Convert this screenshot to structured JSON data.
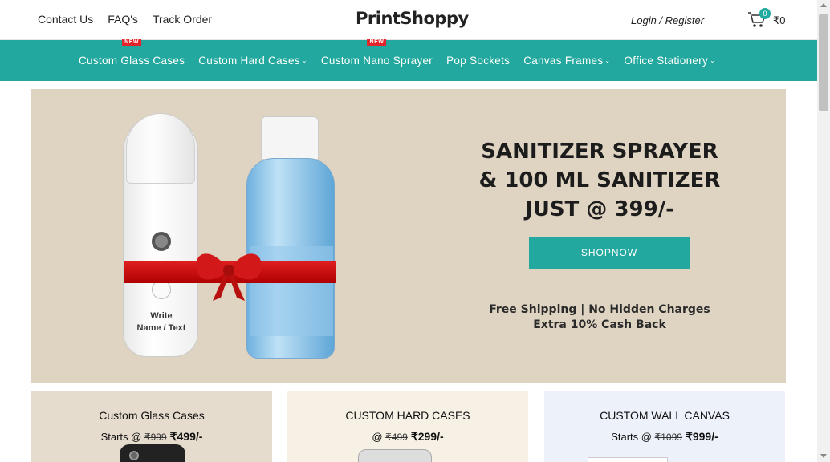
{
  "header": {
    "links": [
      "Contact Us",
      "FAQ's",
      "Track Order"
    ],
    "logo": "PrintShoppy",
    "login": "Login / Register",
    "cart_count": "0",
    "cart_total": "₹0"
  },
  "nav": {
    "items": [
      {
        "label": "Custom Glass Cases",
        "badge": "NEW",
        "dropdown": false
      },
      {
        "label": "Custom Hard Cases",
        "badge": "",
        "dropdown": true
      },
      {
        "label": "Custom Nano Sprayer",
        "badge": "NEW",
        "dropdown": false
      },
      {
        "label": "Pop Sockets",
        "badge": "",
        "dropdown": false
      },
      {
        "label": "Canvas Frames",
        "badge": "",
        "dropdown": true
      },
      {
        "label": "Office Stationery",
        "badge": "",
        "dropdown": true
      }
    ],
    "accent": "#22a89e",
    "badge_color": "#e4232a"
  },
  "banner": {
    "headline_1": "SANITIZER SPRAYER",
    "headline_2": "& 100 ML SANITIZER",
    "headline_3": "JUST @ 399/-",
    "button": "SHOPNOW",
    "sub_1": "Free Shipping | No Hidden Charges",
    "sub_2": "Extra 10% Cash Back",
    "product_text_1": "Write",
    "product_text_2": "Name / Text"
  },
  "cards": [
    {
      "title": "Custom Glass Cases",
      "prefix": "Starts @",
      "old_price": "₹999",
      "price": "₹499/-"
    },
    {
      "title": "CUSTOM HARD CASES",
      "prefix": "@",
      "old_price": "₹499",
      "price": "₹299/-"
    },
    {
      "title": "CUSTOM WALL CANVAS",
      "prefix": "Starts @",
      "old_price": "₹1099",
      "price": "₹999/-"
    }
  ]
}
